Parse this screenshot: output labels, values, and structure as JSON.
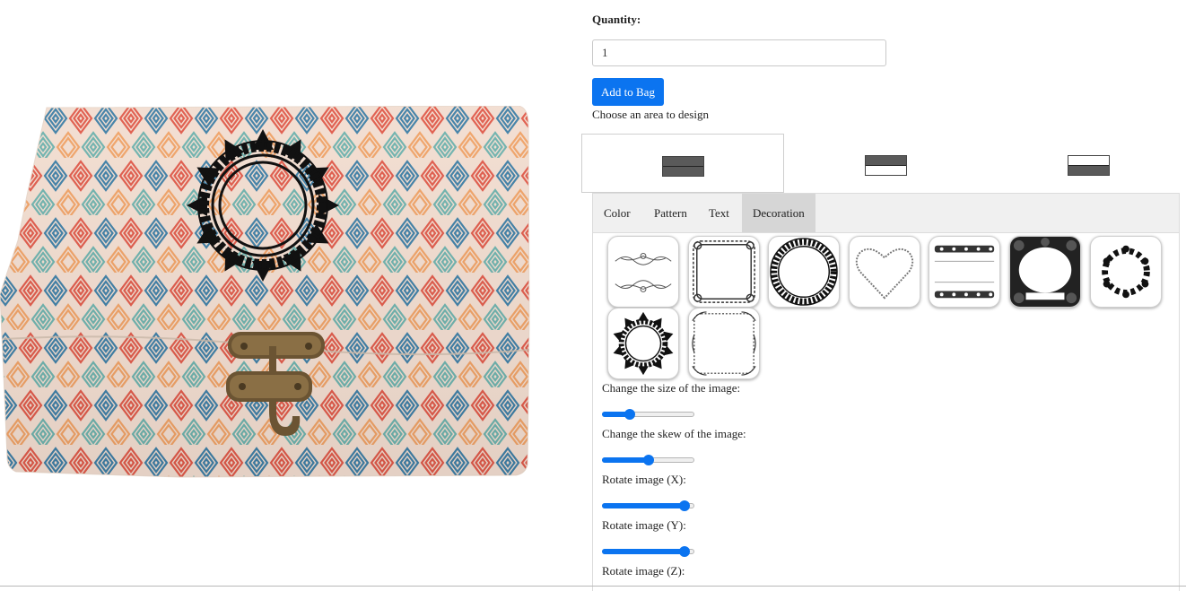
{
  "product": {
    "alt": "decorated wooden box preview",
    "colors": {
      "red": "#e05a4a",
      "blue": "#3f7fa6",
      "teal": "#6eb2ad",
      "orange": "#f0a266",
      "wood": "#f2ddd0",
      "decoration": "#111111",
      "latch": "#6b5433"
    }
  },
  "quantity": {
    "label": "Quantity:",
    "value": "1"
  },
  "add_to_bag": {
    "label": "Add to Bag"
  },
  "choose_area": {
    "label": "Choose an area to design"
  },
  "areas": [
    {
      "id": "area-1",
      "selected": true,
      "top_color": "#5a5a5a",
      "bottom_color": "#5a5a5a"
    },
    {
      "id": "area-2",
      "selected": false,
      "top_color": "#5a5a5a",
      "bottom_color": "#ffffff"
    },
    {
      "id": "area-3",
      "selected": false,
      "top_color": "#ffffff",
      "bottom_color": "#5a5a5a"
    }
  ],
  "tabs": [
    {
      "label": "Color",
      "active": false
    },
    {
      "label": "Pattern",
      "active": false
    },
    {
      "label": "Text",
      "active": false
    },
    {
      "label": "Decoration",
      "active": true
    }
  ],
  "decorations": [
    {
      "icon": "ornament-flourish-icon"
    },
    {
      "icon": "ornate-square-frame-icon"
    },
    {
      "icon": "greek-key-circle-frame-icon"
    },
    {
      "icon": "heart-frame-icon"
    },
    {
      "icon": "floral-border-bands-icon"
    },
    {
      "icon": "damask-label-frame-icon"
    },
    {
      "icon": "leaf-wreath-icon"
    },
    {
      "icon": "mandala-ring-icon"
    },
    {
      "icon": "filigree-square-frame-icon"
    }
  ],
  "controls": {
    "size": {
      "label": "Change the size of the image:",
      "value": 0.27
    },
    "skew": {
      "label": "Change the skew of the image:",
      "value": 0.5
    },
    "rotate_x": {
      "label": "Rotate image (X):",
      "value": 0.95
    },
    "rotate_y": {
      "label": "Rotate image (Y):",
      "value": 0.95
    },
    "rotate_z": {
      "label": "Rotate image (Z):"
    }
  },
  "accent_color": "#0b74f0"
}
